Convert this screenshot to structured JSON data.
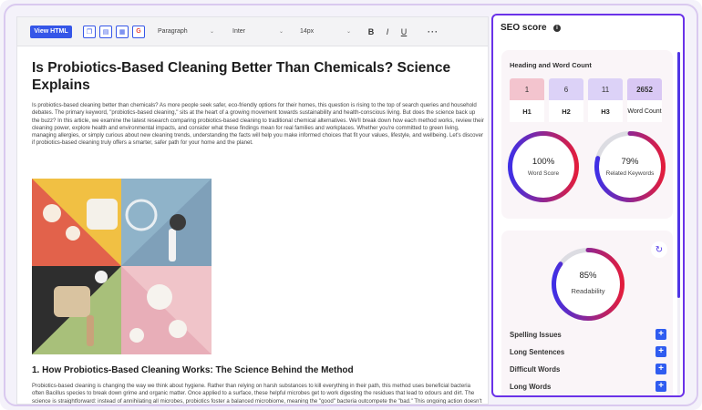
{
  "toolbar": {
    "view_html_label": "View HTML",
    "icons": [
      "copy-icon",
      "doc-icon",
      "pdf-icon",
      "google-icon"
    ],
    "paragraph_select": "Paragraph",
    "font_select": "Inter",
    "size_select": "14px",
    "bold": "B",
    "italic": "I",
    "underline": "U",
    "more": "···"
  },
  "document": {
    "title": "Is Probiotics-Based Cleaning Better Than Chemicals? Science Explains",
    "intro": "Is probiotics-based cleaning better than chemicals? As more people seek safer, eco-friendly options for their homes, this question is rising to the top of search queries and household debates. The primary keyword, \"probiotics-based cleaning,\" sits at the heart of a growing movement towards sustainability and health-conscious living. But does the science back up the buzz? In this article, we examine the latest research comparing probiotics-based cleaning to traditional chemical alternatives. We'll break down how each method works, review their cleaning power, explore health and environmental impacts, and consider what these findings mean for real families and workplaces. Whether you're committed to green living, managing allergies, or simply curious about new cleaning trends, understanding the facts will help you make informed choices that fit your values, lifestyle, and wellbeing. Let's discover if probiotics-based cleaning truly offers a smarter, safer path for your home and the planet.",
    "section_title": "1. How Probiotics-Based Cleaning Works: The Science Behind the Method",
    "section_body": "Probiotics-based cleaning is changing the way we think about hygiene. Rather than relying on harsh substances to kill everything in their path, this method uses beneficial bacteria often Bacillus species to break down grime and organic matter. Once applied to a surface, these helpful microbes get to work digesting the residues that lead to odours and dirt. The science is straightforward: instead of annihilating all microbes, probiotics foster a balanced microbiome, meaning the \"good\" bacteria outcompete the \"bad.\" This ongoing action doesn't just clean in the moment; it can continue for hours, helping"
  },
  "seo": {
    "title": "SEO score",
    "heading_card_title": "Heading and Word Count",
    "headings": [
      {
        "count": "1",
        "label": "H1"
      },
      {
        "count": "6",
        "label": "H2"
      },
      {
        "count": "11",
        "label": "H3"
      },
      {
        "count": "2652",
        "label": "Word Count"
      }
    ],
    "word_score": {
      "value": "100%",
      "label": "Word Score",
      "fraction": 1.0
    },
    "related_keywords": {
      "value": "79%",
      "label": "Related Keywords",
      "fraction": 0.79
    },
    "readability": {
      "value": "85%",
      "label": "Readability",
      "fraction": 0.85
    },
    "issues": [
      "Spelling Issues",
      "Long Sentences",
      "Difficult Words",
      "Long Words"
    ],
    "accent": "#2f5cf0",
    "gauge_colors": [
      "#e21d3d",
      "#3f2fe6"
    ]
  }
}
